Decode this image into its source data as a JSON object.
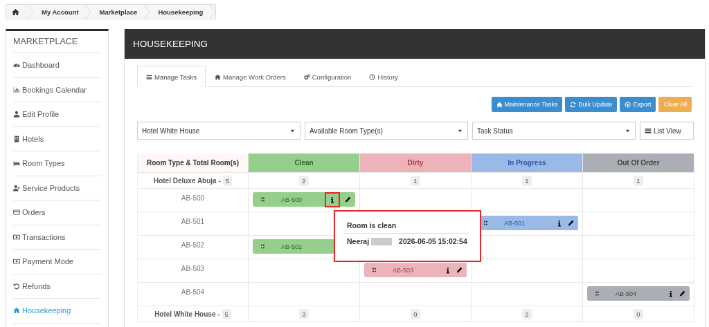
{
  "breadcrumb": [
    {
      "kind": "home"
    },
    {
      "kind": "link",
      "label": "My Account"
    },
    {
      "kind": "link",
      "label": "Marketplace"
    },
    {
      "kind": "link",
      "label": "Housekeeping"
    }
  ],
  "sidebar": {
    "title": "MARKETPLACE",
    "items": [
      {
        "kind": "gauge",
        "label": "Dashboard",
        "selected": false
      },
      {
        "kind": "chart",
        "label": "Bookings Calendar",
        "selected": false
      },
      {
        "kind": "user",
        "label": "Edit Profile",
        "selected": false
      },
      {
        "kind": "building",
        "label": "Hotels",
        "selected": false
      },
      {
        "kind": "bed",
        "label": "Room Types",
        "selected": false
      },
      {
        "kind": "userplus",
        "label": "Service Products",
        "selected": false
      },
      {
        "kind": "card",
        "label": "Orders",
        "selected": false
      },
      {
        "kind": "money",
        "label": "Transactions",
        "selected": false
      },
      {
        "kind": "money",
        "label": "Payment Mode",
        "selected": false
      },
      {
        "kind": "undo",
        "label": "Refunds",
        "selected": false
      },
      {
        "kind": "home",
        "label": "Housekeeping",
        "selected": true
      }
    ]
  },
  "panel": {
    "title": "HOUSEKEEPING",
    "tabs": [
      {
        "kind": "list",
        "label": "Manage Tasks",
        "selected": true
      },
      {
        "kind": "home",
        "label": "Manage Work Orders",
        "selected": false
      },
      {
        "kind": "gears",
        "label": "Configuration",
        "selected": false
      },
      {
        "kind": "clock",
        "label": "History",
        "selected": false
      }
    ],
    "actions": [
      {
        "kind": "maintenance",
        "label": "Maintenance Tasks"
      },
      {
        "kind": "bulk",
        "label": "Bulk Update"
      },
      {
        "kind": "export",
        "label": "Export"
      },
      {
        "kind": "clear",
        "label": "Clear All"
      }
    ],
    "filters": [
      {
        "value": "Hotel White House"
      },
      {
        "value": "Available Room Type(s)"
      },
      {
        "value": "Task Status"
      }
    ],
    "view_button": {
      "label": "List View"
    },
    "table": {
      "first_column": "Room Type & Total Room(s)",
      "columns": [
        {
          "label": "Clean",
          "kind": "clean"
        },
        {
          "label": "Dirty",
          "kind": "dirty"
        },
        {
          "label": "In Progress",
          "kind": "progress"
        },
        {
          "label": "Out Of Order",
          "kind": "outoforder"
        }
      ],
      "groups": [
        {
          "name": "Hotel Deluxe Abuja -",
          "total": "5",
          "counts": [
            "2",
            "1",
            "1",
            "1"
          ],
          "rooms": [
            {
              "name": "AB-500",
              "kind": "clean",
              "card_label": "AB-500",
              "info_highlighted": true
            },
            {
              "name": "AB-501",
              "kind": "progress",
              "card_label": "AB-501",
              "info_highlighted": false
            },
            {
              "name": "AB-502",
              "kind": "clean",
              "card_label": "AB-502",
              "info_highlighted": false
            },
            {
              "name": "AB-503",
              "kind": "dirty",
              "card_label": "AB-503",
              "info_highlighted": false
            },
            {
              "name": "AB-504",
              "kind": "outoforder",
              "card_label": "AB-504",
              "info_highlighted": false
            }
          ]
        },
        {
          "name": "Hotel White House -",
          "total": "5",
          "counts": [
            "3",
            "0",
            "2",
            "0"
          ]
        }
      ]
    },
    "popover": {
      "title": "Room is clean",
      "user": "Neeraj",
      "time": "2026-06-05 15:02:54"
    }
  }
}
